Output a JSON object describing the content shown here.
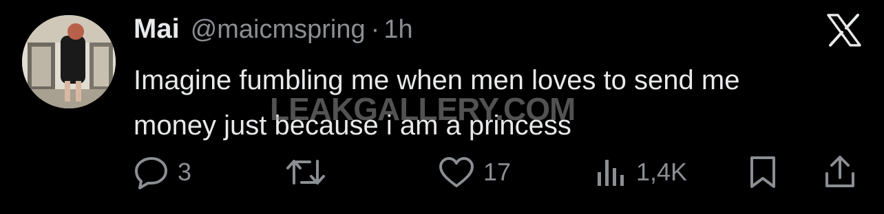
{
  "tweet": {
    "author_name": "Mai",
    "handle": "@maicmspring",
    "separator": "·",
    "time": "1h",
    "text_line1": "Imagine fumbling me when men loves to send me",
    "text_line2": "money just because i am a princess",
    "watermark": "LEAKGALLERY.COM"
  },
  "actions": {
    "replies": "3",
    "retweets": "",
    "likes": "17",
    "views": "1,4K"
  },
  "icons": {
    "close": "x-logo-icon",
    "reply": "reply-icon",
    "retweet": "retweet-icon",
    "like": "heart-icon",
    "views": "views-chart-icon",
    "bookmark": "bookmark-icon",
    "share": "share-icon"
  },
  "colors": {
    "background": "#000000",
    "primary_text": "#e7e9ea",
    "secondary_text": "#8b8f93"
  }
}
